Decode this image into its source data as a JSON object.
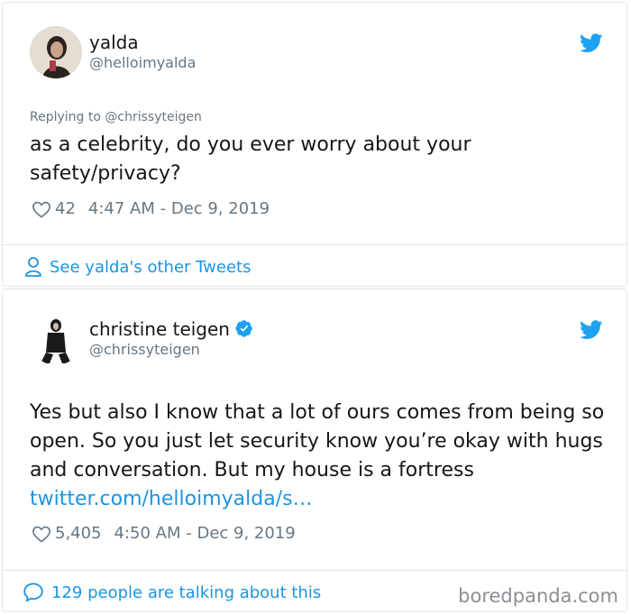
{
  "tweet1": {
    "name": "yalda",
    "handle": "@helloimyalda",
    "replying_prefix": "Replying to ",
    "replying_to": "@chrissyteigen",
    "text": "as a celebrity, do you ever worry about your safety/privacy?",
    "likes": "42",
    "timestamp": "4:47 AM - Dec 9, 2019",
    "footer_link": "See yalda's other Tweets"
  },
  "tweet2": {
    "name": "christine teigen",
    "handle": "@chrissyteigen",
    "text": "Yes but also I know that a lot of ours comes from being so open. So you just let security know you’re okay with hugs and conversation. But my house is a fortress ",
    "link": "twitter.com/helloimyalda/s…",
    "likes": "5,405",
    "timestamp": "4:50 AM - Dec 9, 2019",
    "footer_link": "129 people are talking about this"
  },
  "watermark": "boredpanda.com",
  "colors": {
    "twitter_blue": "#1da1f2",
    "link_blue": "#1b95e0",
    "muted_gray": "#657786",
    "border": "#e1e8ed"
  },
  "icons": [
    "twitter-bird-icon",
    "heart-icon",
    "person-icon",
    "speech-bubble-icon",
    "verified-badge-icon"
  ]
}
